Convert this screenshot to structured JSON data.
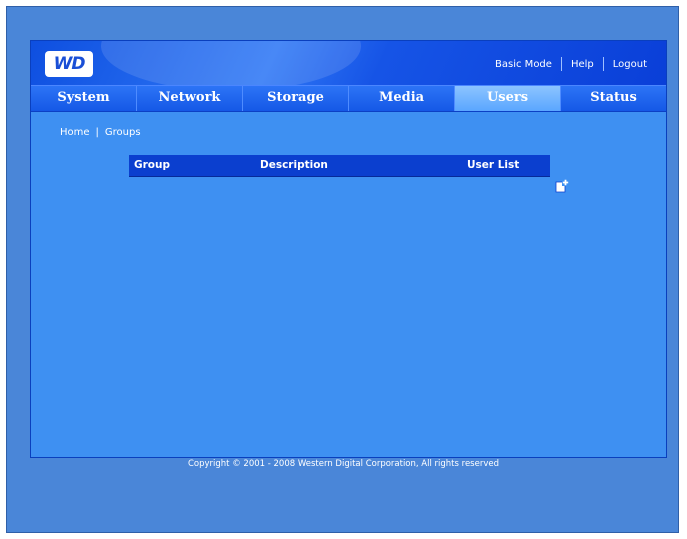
{
  "header": {
    "logo_text": "WD",
    "links": {
      "basic_mode": "Basic Mode",
      "help": "Help",
      "logout": "Logout"
    }
  },
  "tabs": [
    "System",
    "Network",
    "Storage",
    "Media",
    "Users",
    "Status"
  ],
  "active_tab": "Users",
  "breadcrumb": {
    "home": "Home",
    "separator": "|",
    "current": "Groups"
  },
  "table": {
    "columns": [
      "Group",
      "Description",
      "User List"
    ],
    "rows": []
  },
  "icons": {
    "add_group": "add-group-icon"
  },
  "footer": {
    "copyright": "Copyright © 2001 - 2008 Western Digital Corporation, All rights reserved"
  },
  "colors": {
    "background": "#4a86d8",
    "panel": "#3e90f2",
    "table_header": "#0b3fcf",
    "active_tab": "#6fb2ff"
  }
}
